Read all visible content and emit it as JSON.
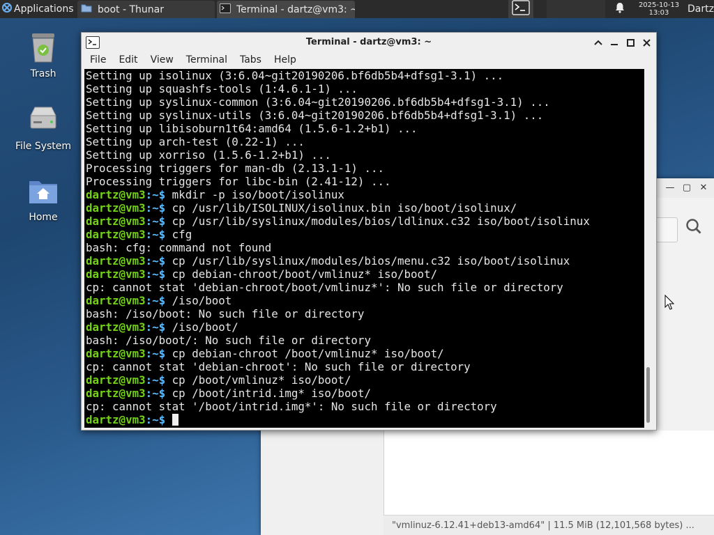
{
  "panel": {
    "applications_label": "Applications",
    "tasks": [
      {
        "label": "boot - Thunar"
      },
      {
        "label": "Terminal - dartz@vm3: ~"
      }
    ],
    "clock_date": "2025-10-13",
    "clock_time": "13:03",
    "user": "Dartz"
  },
  "desktop": {
    "icons": [
      {
        "label": "Trash"
      },
      {
        "label": "File System"
      },
      {
        "label": "Home"
      }
    ]
  },
  "thunar": {
    "status": "\"vmlinuz-6.12.41+deb13-amd64\"  |  11.5 MiB (12,101,568 bytes) ..."
  },
  "terminal": {
    "title": "Terminal - dartz@vm3: ~",
    "menu": [
      "File",
      "Edit",
      "View",
      "Terminal",
      "Tabs",
      "Help"
    ],
    "prompt_user": "dartz@vm3",
    "prompt_path": ":~$",
    "lines": [
      {
        "type": "out",
        "text": "Setting up isolinux (3:6.04~git20190206.bf6db5b4+dfsg1-3.1) ..."
      },
      {
        "type": "out",
        "text": "Setting up squashfs-tools (1:4.6.1-1) ..."
      },
      {
        "type": "out",
        "text": "Setting up syslinux-common (3:6.04~git20190206.bf6db5b4+dfsg1-3.1) ..."
      },
      {
        "type": "out",
        "text": "Setting up syslinux-utils (3:6.04~git20190206.bf6db5b4+dfsg1-3.1) ..."
      },
      {
        "type": "out",
        "text": "Setting up libisoburn1t64:amd64 (1.5.6-1.2+b1) ..."
      },
      {
        "type": "out",
        "text": "Setting up arch-test (0.22-1) ..."
      },
      {
        "type": "out",
        "text": "Setting up xorriso (1.5.6-1.2+b1) ..."
      },
      {
        "type": "out",
        "text": "Processing triggers for man-db (2.13.1-1) ..."
      },
      {
        "type": "out",
        "text": "Processing triggers for libc-bin (2.41-12) ..."
      },
      {
        "type": "cmd",
        "text": " mkdir -p iso/boot/isolinux"
      },
      {
        "type": "cmd",
        "text": " cp /usr/lib/ISOLINUX/isolinux.bin iso/boot/isolinux/"
      },
      {
        "type": "cmd",
        "text": " cp /usr/lib/syslinux/modules/bios/ldlinux.c32 iso/boot/isolinux"
      },
      {
        "type": "cmd",
        "text": " cfg"
      },
      {
        "type": "out",
        "text": "bash: cfg: command not found"
      },
      {
        "type": "cmd",
        "text": " cp /usr/lib/syslinux/modules/bios/menu.c32 iso/boot/isolinux"
      },
      {
        "type": "cmd",
        "text": " cp debian-chroot/boot/vmlinuz* iso/boot/"
      },
      {
        "type": "out",
        "text": "cp: cannot stat 'debian-chroot/boot/vmlinuz*': No such file or directory"
      },
      {
        "type": "cmd",
        "text": " /iso/boot"
      },
      {
        "type": "out",
        "text": "bash: /iso/boot: No such file or directory"
      },
      {
        "type": "cmd",
        "text": " /iso/boot/"
      },
      {
        "type": "out",
        "text": "bash: /iso/boot/: No such file or directory"
      },
      {
        "type": "cmd",
        "text": " cp debian-chroot /boot/vmlinuz* iso/boot/"
      },
      {
        "type": "out",
        "text": "cp: cannot stat 'debian-chroot': No such file or directory"
      },
      {
        "type": "cmd",
        "text": " cp /boot/vmlinuz* iso/boot/"
      },
      {
        "type": "cmd",
        "text": " cp /boot/intrid.img* iso/boot/"
      },
      {
        "type": "out",
        "text": "cp: cannot stat '/boot/intrid.img*': No such file or directory"
      },
      {
        "type": "cursor",
        "text": " "
      }
    ]
  },
  "colors": {
    "prompt_user": "#73d216",
    "prompt_path": "#5bbcfd",
    "terminal_bg": "#000000",
    "terminal_fg": "#e6e6e6"
  }
}
